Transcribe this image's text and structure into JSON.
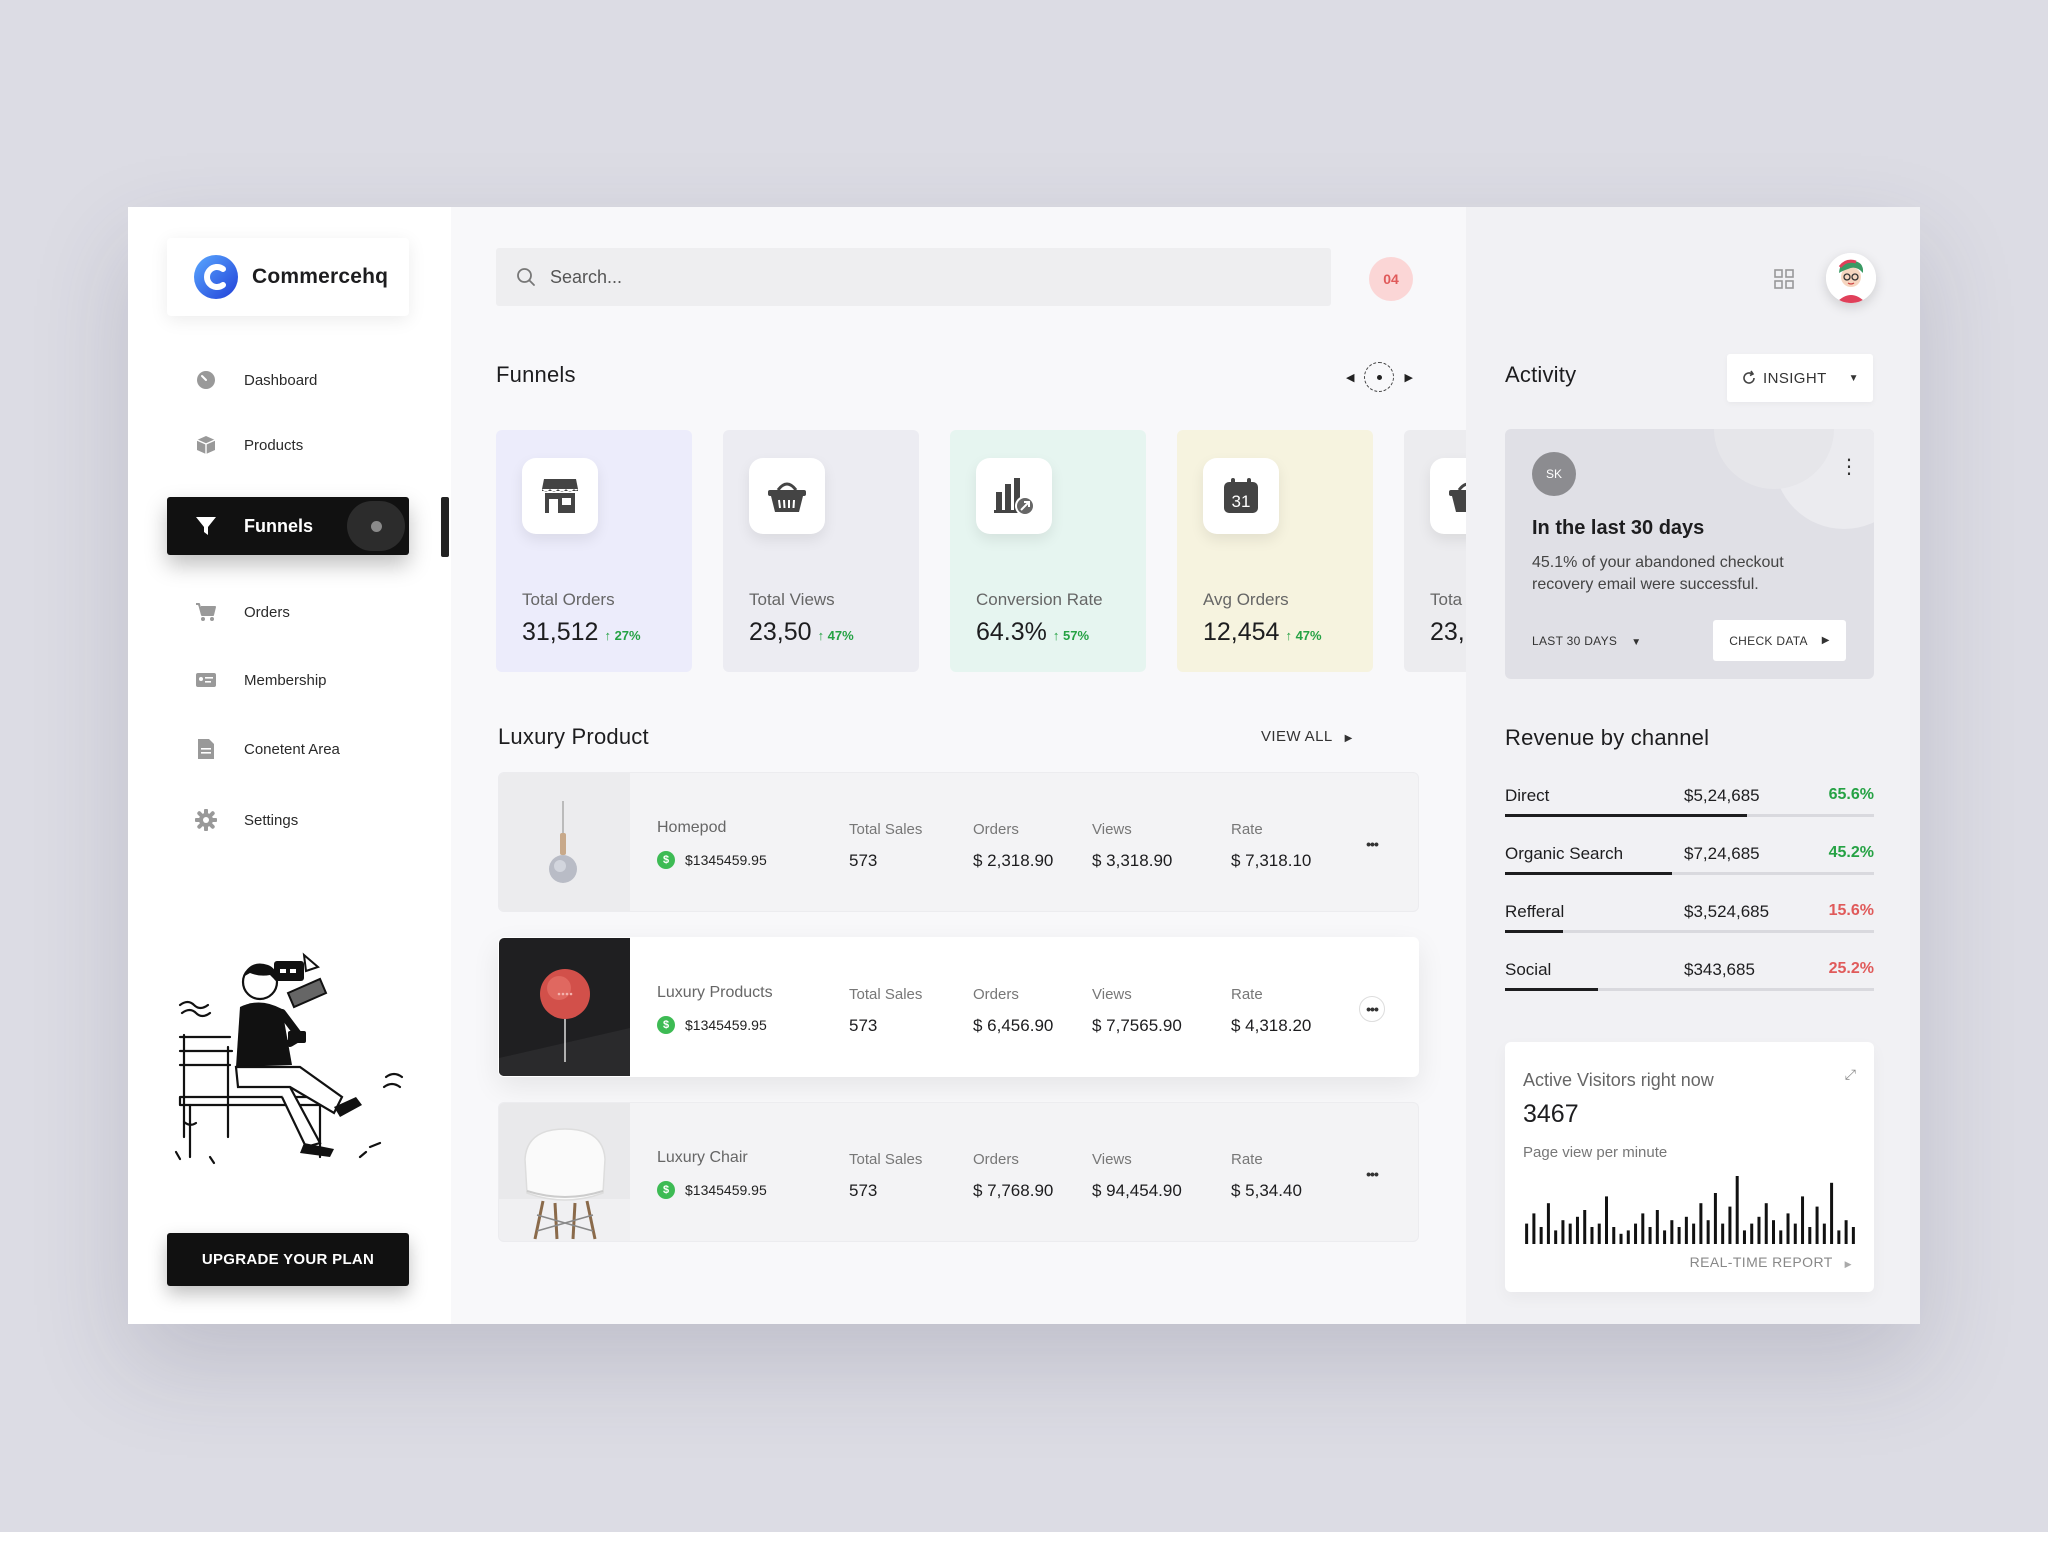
{
  "brand": {
    "name": "Commercehq"
  },
  "sidebar": {
    "items": [
      {
        "label": "Dashboard",
        "icon": "dashboard-icon"
      },
      {
        "label": "Products",
        "icon": "box-icon"
      },
      {
        "label": "Funnels",
        "icon": "funnel-icon",
        "active": true
      },
      {
        "label": "Orders",
        "icon": "cart-icon"
      },
      {
        "label": "Membership",
        "icon": "id-card-icon"
      },
      {
        "label": "Conetent Area",
        "icon": "document-icon"
      },
      {
        "label": "Settings",
        "icon": "gear-icon"
      }
    ],
    "upgrade_label": "UPGRADE YOUR PLAN"
  },
  "search": {
    "placeholder": "Search..."
  },
  "notifications": {
    "count": "04"
  },
  "funnels": {
    "title": "Funnels",
    "cards": [
      {
        "label": "Total Orders",
        "value": "31,512",
        "change": "↑ 27%",
        "bg": "#ececfb",
        "icon": "store-icon"
      },
      {
        "label": "Total Views",
        "value": "23,50",
        "change": "↑ 47%",
        "bg": "#ececf2",
        "icon": "basket-icon"
      },
      {
        "label": "Conversion Rate",
        "value": "64.3%",
        "change": "↑ 57%",
        "bg": "#e6f5f0",
        "icon": "bar-chart-icon"
      },
      {
        "label": "Avg Orders",
        "value": "12,454",
        "change": "↑ 47%",
        "bg": "#f6f3df",
        "icon": "calendar-icon",
        "icon_text": "31"
      },
      {
        "label": "Tota",
        "value": "23,",
        "change": "",
        "bg": "#ececef",
        "icon": "basket-icon"
      }
    ]
  },
  "products": {
    "title": "Luxury Product",
    "view_all": "VIEW ALL",
    "columns": {
      "sales": "Total Sales",
      "orders": "Orders",
      "views": "Views",
      "rate": "Rate"
    },
    "rows": [
      {
        "name": "Homepod",
        "amount": "$1345459.95",
        "sales": "573",
        "orders": "$ 2,318.90",
        "views": "$ 3,318.90",
        "rate": "$ 7,318.10"
      },
      {
        "name": "Luxury Products",
        "amount": "$1345459.95",
        "sales": "573",
        "orders": "$ 6,456.90",
        "views": "$ 7,7565.90",
        "rate": "$ 4,318.20"
      },
      {
        "name": "Luxury Chair",
        "amount": "$1345459.95",
        "sales": "573",
        "orders": "$ 7,768.90",
        "views": "$ 94,454.90",
        "rate": "$ 5,34.40"
      }
    ],
    "coin_symbol": "$"
  },
  "activity": {
    "title": "Activity",
    "insight_label": "INSIGHT",
    "avatar_initials": "SK",
    "card_title": "In the last 30 days",
    "card_text": "45.1% of your abandoned checkout recovery email were successful.",
    "range_label": "LAST 30 DAYS",
    "check_label": "CHECK DATA"
  },
  "revenue": {
    "title": "Revenue by channel",
    "channels": [
      {
        "name": "Direct",
        "amount": "$5,24,685",
        "pct": "65.6%",
        "share": 0.656,
        "color": "#25a244"
      },
      {
        "name": "Organic Search",
        "amount": "$7,24,685",
        "pct": "45.2%",
        "share": 0.452,
        "color": "#25a244"
      },
      {
        "name": "Refferal",
        "amount": "$3,524,685",
        "pct": "15.6%",
        "share": 0.156,
        "color": "#e05a5a"
      },
      {
        "name": "Social",
        "amount": "$343,685",
        "pct": "25.2%",
        "share": 0.252,
        "color": "#e05a5a"
      }
    ]
  },
  "visitors": {
    "label": "Active Visitors right now",
    "count": "3467",
    "sub": "Page view per minute",
    "report": "REAL-TIME REPORT",
    "bars": [
      0.3,
      0.45,
      0.25,
      0.6,
      0.2,
      0.35,
      0.3,
      0.4,
      0.5,
      0.25,
      0.3,
      0.7,
      0.25,
      0.15,
      0.2,
      0.3,
      0.45,
      0.25,
      0.5,
      0.2,
      0.35,
      0.25,
      0.4,
      0.3,
      0.6,
      0.35,
      0.75,
      0.3,
      0.55,
      1.0,
      0.2,
      0.3,
      0.4,
      0.6,
      0.35,
      0.2,
      0.45,
      0.3,
      0.7,
      0.25,
      0.55,
      0.3,
      0.9,
      0.2,
      0.35,
      0.25
    ],
    "bar_color": "#111111"
  },
  "colors": {
    "accent": "#111111",
    "positive": "#25a244",
    "negative": "#e05a5a",
    "brand_blue": "#2b6cf0"
  }
}
